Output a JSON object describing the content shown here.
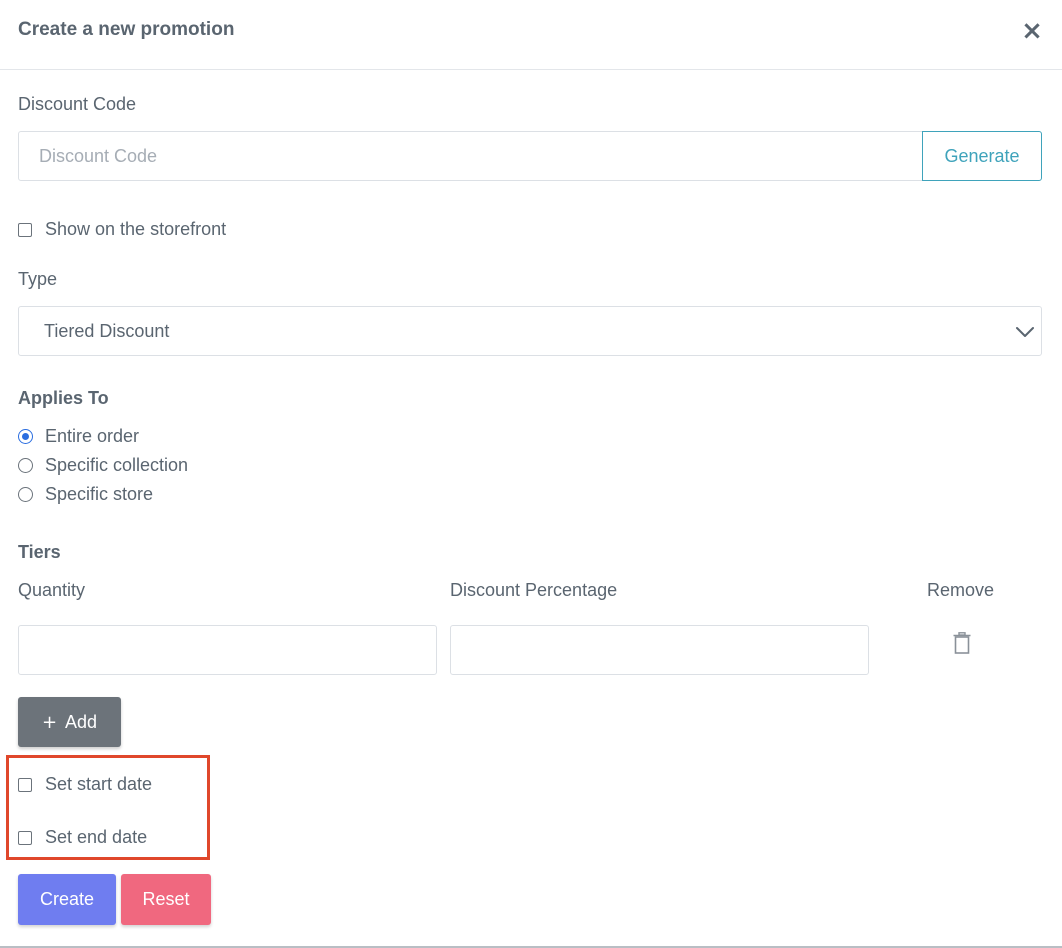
{
  "modal": {
    "title": "Create a new promotion",
    "close_symbol": "×"
  },
  "discount_code": {
    "label": "Discount Code",
    "placeholder": "Discount Code",
    "value": "",
    "generate_label": "Generate"
  },
  "storefront": {
    "label": "Show on the storefront",
    "checked": false
  },
  "type": {
    "label": "Type",
    "selected": "Tiered Discount"
  },
  "applies_to": {
    "label": "Applies To",
    "options": [
      {
        "label": "Entire order",
        "checked": true
      },
      {
        "label": "Specific collection",
        "checked": false
      },
      {
        "label": "Specific store",
        "checked": false
      }
    ]
  },
  "tiers": {
    "label": "Tiers",
    "columns": [
      "Quantity",
      "Discount Percentage",
      "Remove"
    ],
    "rows": [
      {
        "quantity": "",
        "discount_percentage": ""
      }
    ],
    "add_label": "Add",
    "add_icon": "plus-icon",
    "remove_icon": "trash-icon"
  },
  "dates": {
    "start_label": "Set start date",
    "start_checked": false,
    "end_label": "Set end date",
    "end_checked": false
  },
  "actions": {
    "create_label": "Create",
    "reset_label": "Reset"
  },
  "colors": {
    "generate": "#3fa3bb",
    "radio_selected": "#2b6ee0",
    "add_button": "#6c737a",
    "highlight": "#e0472b",
    "create_button": "#6f7df0",
    "reset_button": "#f0687f"
  }
}
